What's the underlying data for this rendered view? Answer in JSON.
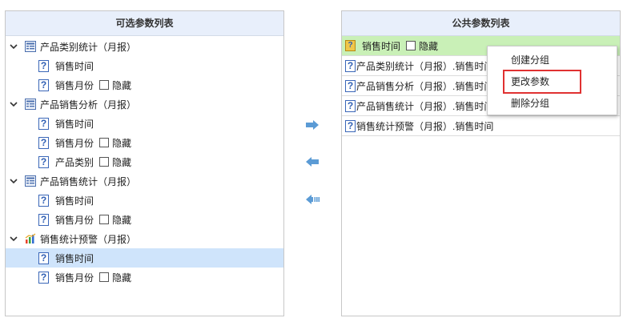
{
  "left_panel": {
    "title": "可选参数列表",
    "groups": [
      {
        "name": "产品类别统计（月报）",
        "icon": "table-report-icon",
        "params": [
          {
            "label": "销售时间",
            "has_hide": false
          },
          {
            "label": "销售月份",
            "has_hide": true
          }
        ]
      },
      {
        "name": "产品销售分析（月报）",
        "icon": "table-report-icon",
        "params": [
          {
            "label": "销售时间",
            "has_hide": false
          },
          {
            "label": "销售月份",
            "has_hide": true
          },
          {
            "label": "产品类别",
            "has_hide": true
          }
        ]
      },
      {
        "name": "产品销售统计（月报）",
        "icon": "table-report-icon",
        "params": [
          {
            "label": "销售时间",
            "has_hide": false
          },
          {
            "label": "销售月份",
            "has_hide": true
          }
        ]
      },
      {
        "name": "销售统计预警（月报）",
        "icon": "bar-chart-icon",
        "params": [
          {
            "label": "销售时间",
            "has_hide": false,
            "selected": true
          },
          {
            "label": "销售月份",
            "has_hide": true
          }
        ]
      }
    ],
    "hide_label": "隐藏"
  },
  "right_panel": {
    "title": "公共参数列表",
    "group_row": {
      "label": "销售时间",
      "hide_label": "隐藏"
    },
    "items": [
      "产品类别统计（月报）.销售时间",
      "产品销售分析（月报）.销售时间",
      "产品销售统计（月报）.销售时间",
      "销售统计预警（月报）.销售时间"
    ]
  },
  "context_menu": {
    "items": [
      "创建分组",
      "更改参数",
      "删除分组"
    ],
    "highlighted": "更改参数"
  },
  "colors": {
    "header_bg": "#e8effb",
    "selected_row": "#cfe4fb",
    "group_row_bg": "#c9f0b7",
    "arrow_blue": "#5b9bd5",
    "highlight_border": "#e03131"
  }
}
